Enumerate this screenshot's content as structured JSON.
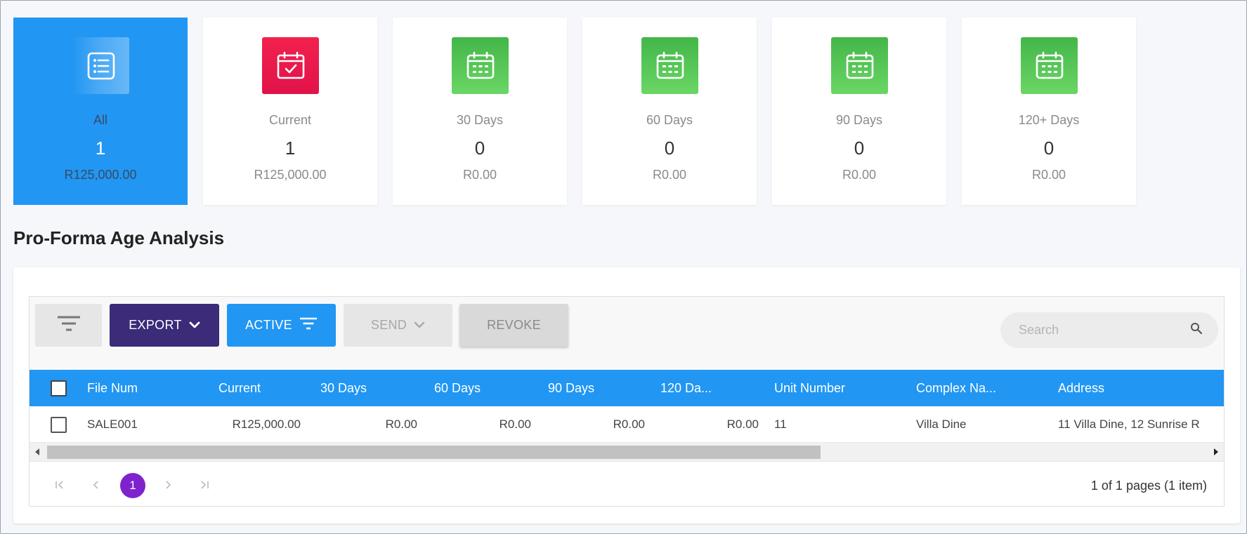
{
  "cards": [
    {
      "label": "All",
      "count": "1",
      "amount": "R125,000.00",
      "icon": "list-icon",
      "color": "#2196f3",
      "active": true
    },
    {
      "label": "Current",
      "count": "1",
      "amount": "R125,000.00",
      "icon": "calendar-check-icon",
      "color": "#ee1a4b"
    },
    {
      "label": "30 Days",
      "count": "0",
      "amount": "R0.00",
      "icon": "calendar-icon",
      "color": "#52c455"
    },
    {
      "label": "60 Days",
      "count": "0",
      "amount": "R0.00",
      "icon": "calendar-icon",
      "color": "#52c455"
    },
    {
      "label": "90 Days",
      "count": "0",
      "amount": "R0.00",
      "icon": "calendar-icon",
      "color": "#52c455"
    },
    {
      "label": "120+ Days",
      "count": "0",
      "amount": "R0.00",
      "icon": "calendar-icon",
      "color": "#52c455"
    }
  ],
  "page": {
    "title": "Pro-Forma Age Analysis"
  },
  "toolbar": {
    "export_label": "EXPORT",
    "active_label": "ACTIVE",
    "send_label": "SEND",
    "revoke_label": "REVOKE",
    "search_placeholder": "Search"
  },
  "table": {
    "columns": [
      "File Num",
      "Current",
      "30 Days",
      "60 Days",
      "90 Days",
      "120 Da...",
      "Unit Number",
      "Complex Na...",
      "Address"
    ],
    "rows": [
      [
        "SALE001",
        "R125,000.00",
        "R0.00",
        "R0.00",
        "R0.00",
        "R0.00",
        "11",
        "Villa Dine",
        "11 Villa Dine, 12 Sunrise R"
      ]
    ]
  },
  "pager": {
    "current_page": "1",
    "info": "1 of 1 pages (1 item)"
  },
  "colors": {
    "primary": "#2196f3",
    "export": "#3b2b79",
    "page_badge": "#7e22ce",
    "danger": "#ee1a4b",
    "success": "#52c455"
  }
}
